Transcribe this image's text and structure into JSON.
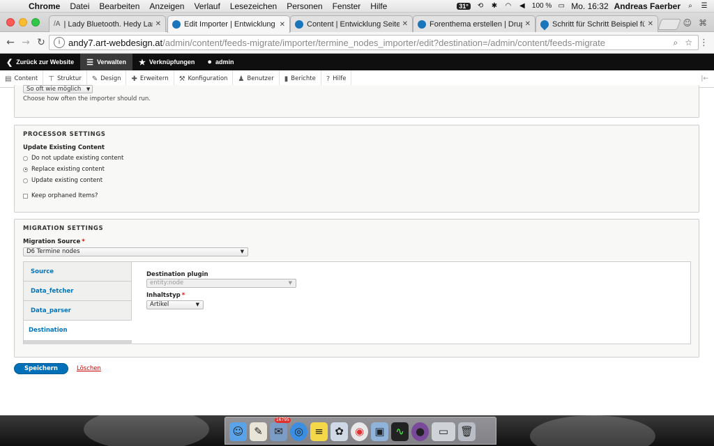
{
  "menubar": {
    "apple": "",
    "items": [
      "Chrome",
      "Datei",
      "Bearbeiten",
      "Anzeigen",
      "Verlauf",
      "Lesezeichen",
      "Personen",
      "Fenster",
      "Hilfe"
    ],
    "temp": "31°",
    "battery": "100 %",
    "clock": "Mo. 16:32",
    "user": "Andreas Faerber"
  },
  "tabs": [
    {
      "title": "| Lady Bluetooth. Hedy Lama",
      "favicon": "af",
      "active": false
    },
    {
      "title": "Edit Importer | Entwicklung",
      "favicon": "drupal",
      "active": true
    },
    {
      "title": "Content | Entwicklung Seite",
      "favicon": "drupal",
      "active": false
    },
    {
      "title": "Forenthema erstellen | Drupa",
      "favicon": "drupal",
      "active": false
    },
    {
      "title": "Schritt für Schritt Beispiel für",
      "favicon": "drupal-drop",
      "active": false
    }
  ],
  "url": {
    "host": "andy7.art-webdesign.at",
    "path": "/admin/content/feeds-migrate/importer/termine_nodes_importer/edit?destination=/admin/content/feeds-migrate"
  },
  "toolbar": {
    "back": "Zurück zur Website",
    "manage": "Verwalten",
    "shortcuts": "Verknüpfungen",
    "user": "admin"
  },
  "tray": [
    "Content",
    "Struktur",
    "Design",
    "Erweitern",
    "Konfiguration",
    "Benutzer",
    "Berichte",
    "Hilfe"
  ],
  "import_period": {
    "value": "So oft wie möglich",
    "description": "Choose how often the importer should run."
  },
  "processor": {
    "legend": "PROCESSOR SETTINGS",
    "update_label": "Update Existing Content",
    "options": [
      {
        "label": "Do not update existing content",
        "checked": false
      },
      {
        "label": "Replace existing content",
        "checked": true
      },
      {
        "label": "Update existing content",
        "checked": false
      }
    ],
    "orphan_label": "Keep orphaned Items?"
  },
  "migration": {
    "legend": "MIGRATION SETTINGS",
    "source_label": "Migration Source",
    "source_value": "D6 Termine nodes",
    "vtabs": [
      "Source",
      "Data_fetcher",
      "Data_parser",
      "Destination"
    ],
    "active_vtab": "Destination",
    "dest_plugin_label": "Destination plugin",
    "dest_plugin_value": "entity:node",
    "type_label": "Inhaltstyp",
    "type_value": "Artikel"
  },
  "actions": {
    "save": "Speichern",
    "delete": "Löschen"
  },
  "dock": {
    "mail_badge": "16795"
  }
}
